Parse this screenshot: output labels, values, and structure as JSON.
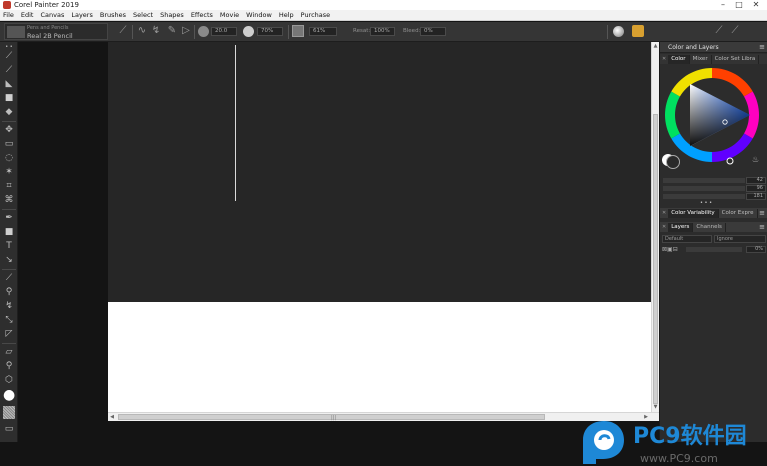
{
  "window": {
    "title": "Corel Painter 2019",
    "minimize": "–",
    "maximize": "□",
    "close": "✕"
  },
  "menu": [
    "File",
    "Edit",
    "Canvas",
    "Layers",
    "Brushes",
    "Select",
    "Shapes",
    "Effects",
    "Movie",
    "Window",
    "Help",
    "Purchase"
  ],
  "property_bar": {
    "brush_category": "Pens and Pencils",
    "brush_variant": "Real 2B Pencil",
    "size": "20.0",
    "opacity": "70%",
    "grain": "61%",
    "resat_label": "Resat:",
    "resat": "100%",
    "bleed_label": "Bleed:",
    "bleed": "0%"
  },
  "color_panel": {
    "title": "Color and Layers",
    "tabs": [
      "Color",
      "Mixer",
      "Color Set Libra"
    ],
    "rgb": {
      "r": "42",
      "g": "96",
      "b": "181"
    },
    "more": "• • •",
    "sub_tabs": [
      "Color Variability",
      "Color Expre"
    ]
  },
  "layers_panel": {
    "tabs": [
      "Layers",
      "Channels"
    ],
    "composite_method": "Default",
    "composite_depth": "Ignore",
    "opacity": "0%"
  },
  "scroll": {
    "grip": "|||"
  },
  "watermark": {
    "brand": "PC9软件园",
    "url": "www.PC9.com"
  },
  "colors": {
    "main_color": "#2a60b5",
    "accent": "#1e88d6",
    "paper": "#ffffff",
    "canvas_bg": "#262626"
  }
}
